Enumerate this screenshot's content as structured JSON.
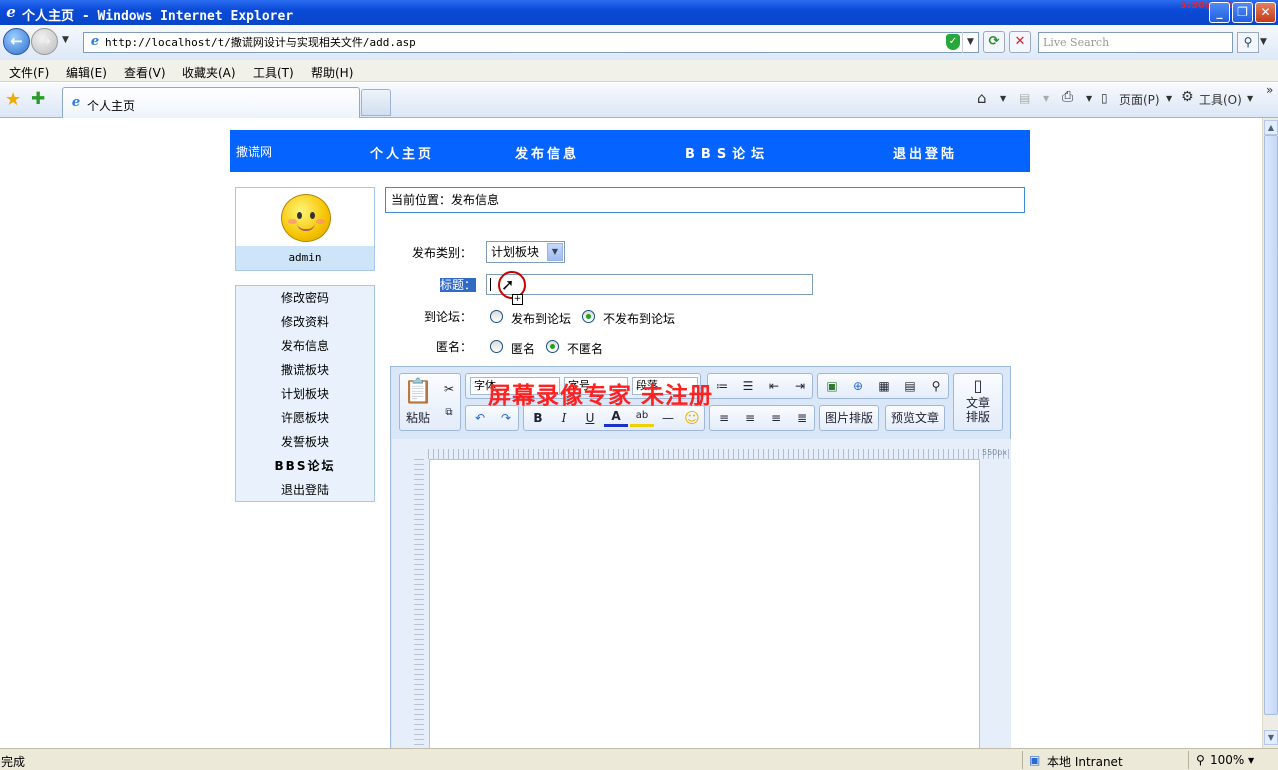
{
  "window": {
    "title": "个人主页 - Windows Internet Explorer",
    "stamp": "5:30@2:14"
  },
  "addressbar": {
    "url": "http://localhost/t/撒谎网设计与实现相关文件/add.asp",
    "search_placeholder": "Live Search"
  },
  "menubar": {
    "items": [
      "文件(F)",
      "编辑(E)",
      "查看(V)",
      "收藏夹(A)",
      "工具(T)",
      "帮助(H)"
    ]
  },
  "tabs": [
    {
      "label": "个人主页"
    }
  ],
  "commandbar": {
    "page": "页面(P)",
    "tools": "工具(O)"
  },
  "site": {
    "brand": "撒谎网",
    "nav": [
      "个人主页",
      "发布信息",
      "BBS论坛",
      "退出登陆"
    ]
  },
  "user": {
    "name": "admin"
  },
  "sidemenu": [
    "修改密码",
    "修改资料",
    "发布信息",
    "撒谎板块",
    "计划板块",
    "许愿板块",
    "发誓板块",
    "BBS论坛",
    "退出登陆"
  ],
  "breadcrumb": "当前位置：发布信息",
  "form": {
    "category_label": "发布类别：",
    "category_value": "计划板块",
    "title_label": "标题：",
    "title_value": "",
    "forum_label": "到论坛：",
    "forum_options": [
      "发布到论坛",
      "不发布到论坛"
    ],
    "forum_selected": 1,
    "anon_label": "匿名：",
    "anon_options": [
      "匿名",
      "不匿名"
    ],
    "anon_selected": 1
  },
  "editor": {
    "paste": "粘贴",
    "font": "字体",
    "size": "字号",
    "paragraph": "段落",
    "image_layout": "图片排版",
    "preview": "预览文章",
    "article_layout_1": "文章",
    "article_layout_2": "排版",
    "bold": "B",
    "italic": "I",
    "underline": "U",
    "font_color": "A",
    "highlight": "ab",
    "ruler_label": "550px"
  },
  "watermark": "屏幕录像专家 未注册",
  "status": {
    "text": "完成",
    "zone": "本地 Intranet",
    "zoom": "100%"
  }
}
